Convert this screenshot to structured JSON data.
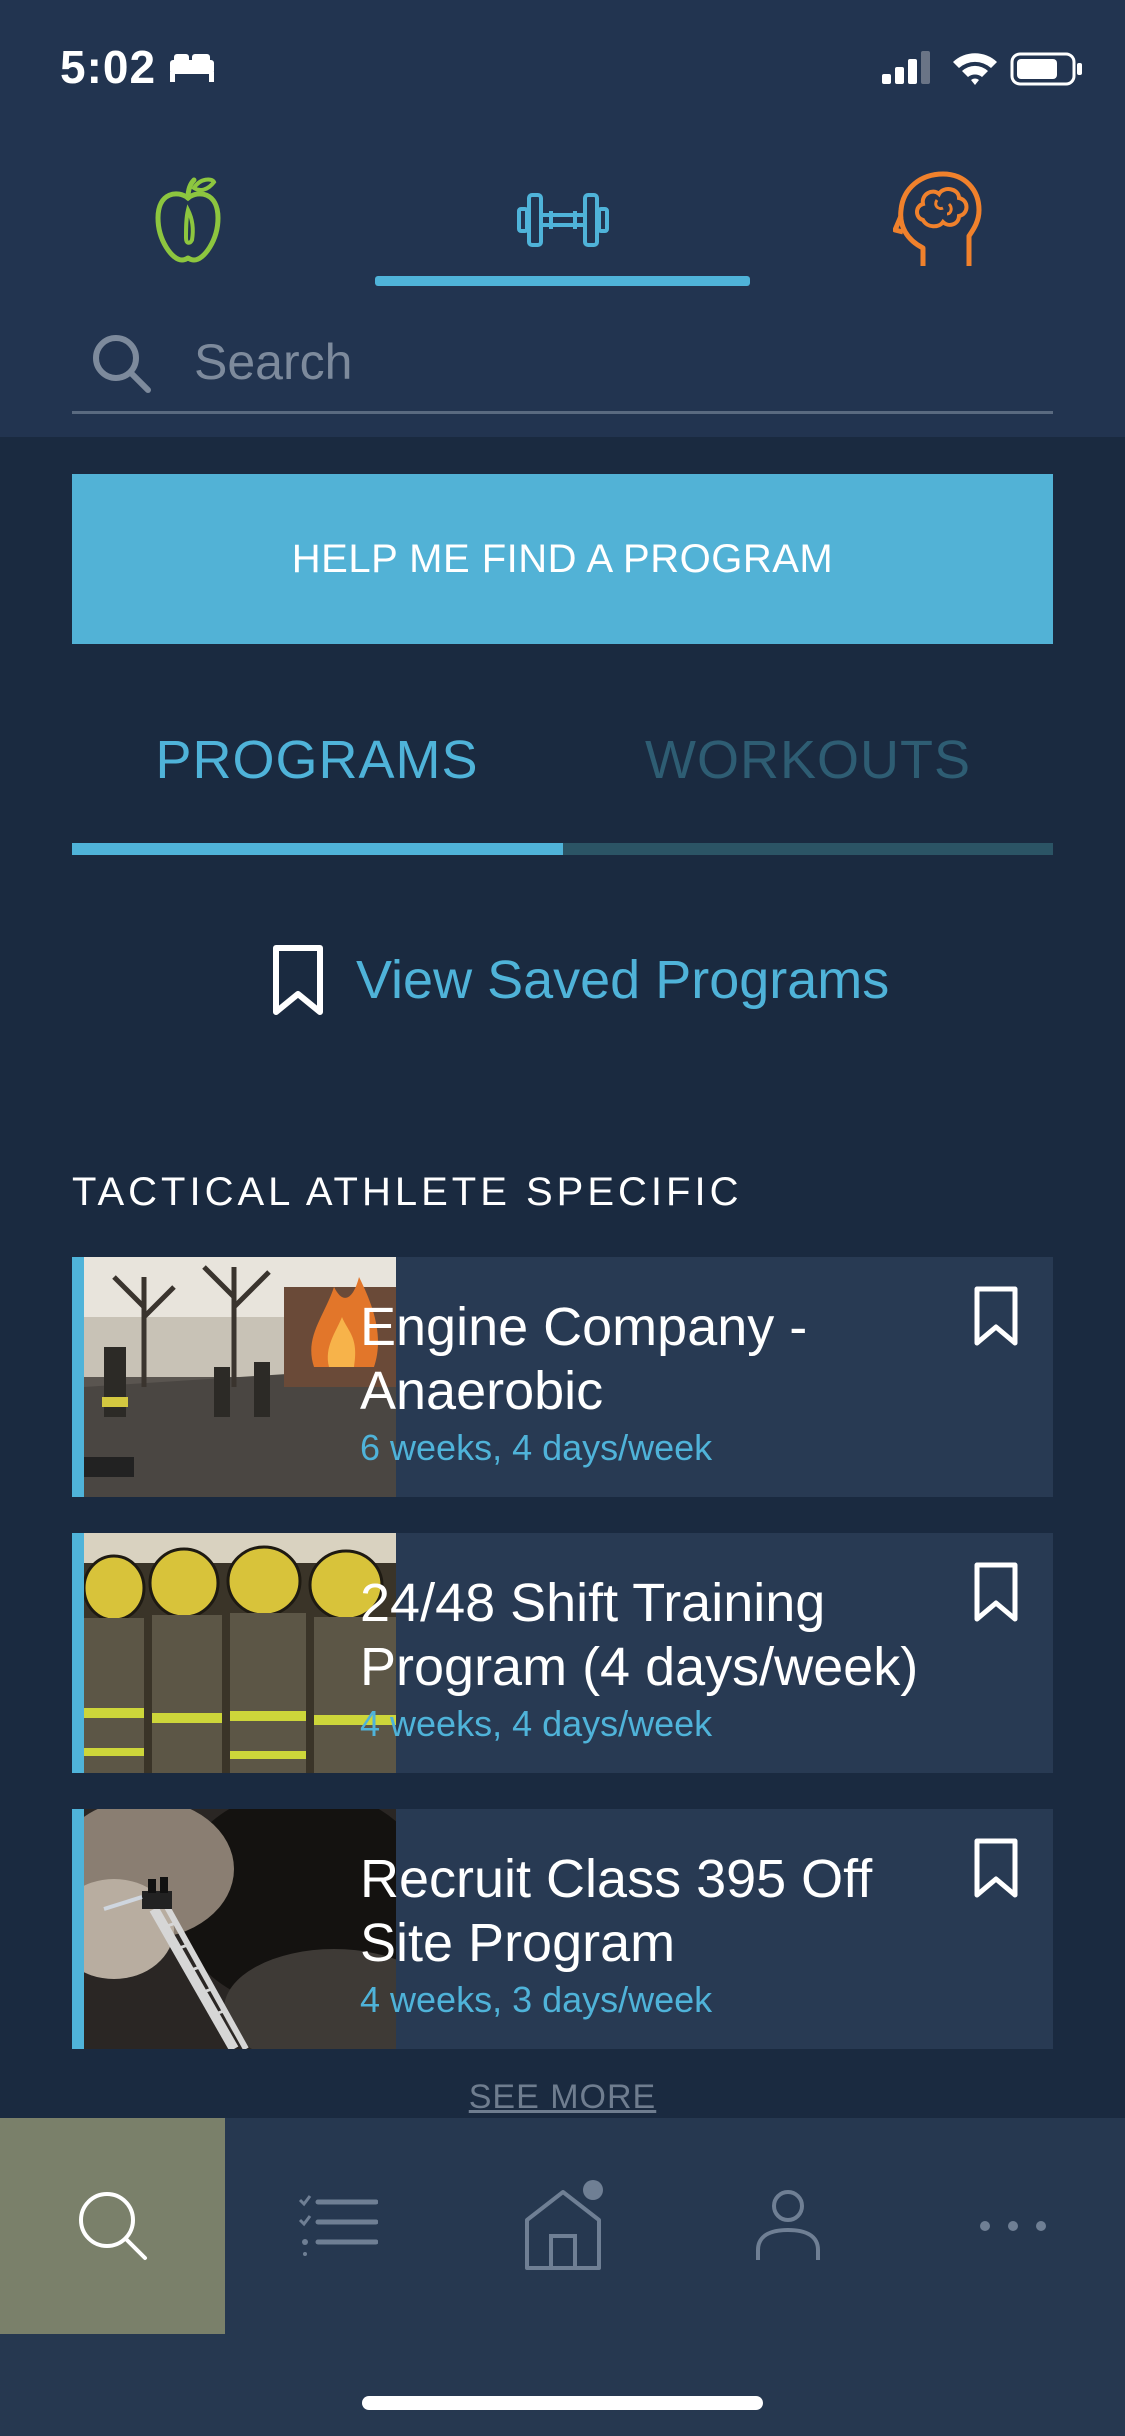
{
  "status_bar": {
    "time": "5:02"
  },
  "categories": [
    {
      "name": "nutrition",
      "icon": "apple-icon",
      "color": "#8dc63f"
    },
    {
      "name": "fitness",
      "icon": "dumbbell-icon",
      "color": "#4fb3d9",
      "selected": true
    },
    {
      "name": "mind",
      "icon": "head-brain-icon",
      "color": "#f0812c"
    }
  ],
  "search": {
    "placeholder": "Search",
    "value": ""
  },
  "find_program_button": "HELP ME FIND A PROGRAM",
  "segments": {
    "programs": "PROGRAMS",
    "workouts": "WORKOUTS",
    "selected": "programs"
  },
  "saved_link": "View Saved Programs",
  "section": {
    "title": "TACTICAL ATHLETE SPECIFIC",
    "programs": [
      {
        "title": "Engine Company - Anaerobic",
        "subtitle": "6 weeks, 4 days/week",
        "thumbnail": "firefighters-at-fire-photo"
      },
      {
        "title": "24/48 Shift Training Program (4 days/week)",
        "subtitle": "4 weeks, 4 days/week",
        "thumbnail": "turnout-gear-rack-photo"
      },
      {
        "title": "Recruit Class 395 Off Site Program",
        "subtitle": "4 weeks, 3 days/week",
        "thumbnail": "aerial-ladder-smoke-photo"
      }
    ],
    "see_more": "SEE MORE"
  },
  "tab_bar": [
    {
      "name": "search",
      "icon": "search-icon",
      "active": true
    },
    {
      "name": "plans",
      "icon": "checklist-icon"
    },
    {
      "name": "home",
      "icon": "home-icon",
      "badge": true
    },
    {
      "name": "profile",
      "icon": "person-icon"
    },
    {
      "name": "more",
      "icon": "more-dots-icon"
    }
  ]
}
